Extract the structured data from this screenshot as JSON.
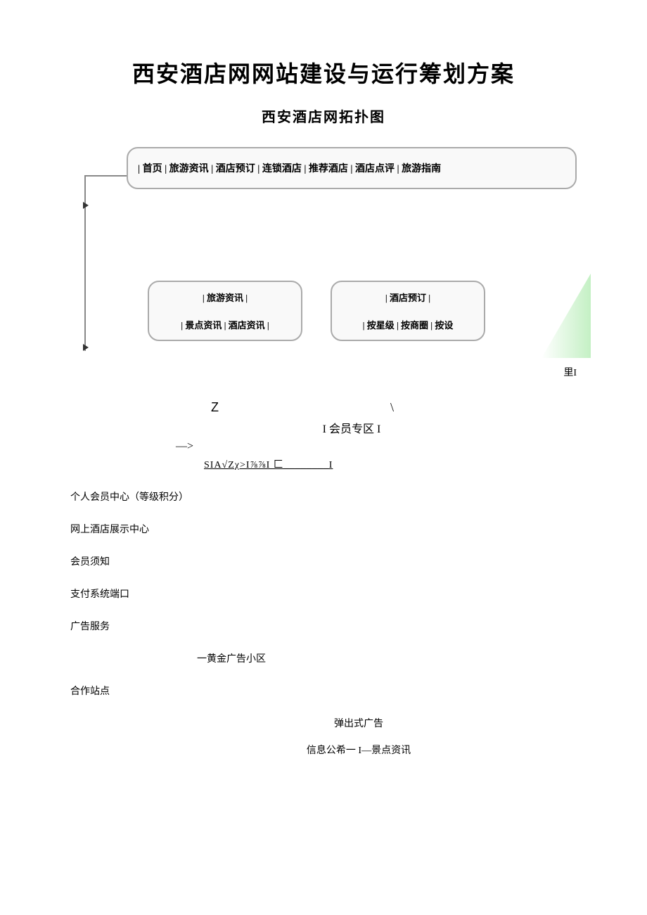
{
  "title": "西安酒店网网站建设与运行筹划方案",
  "subtitle": "西安酒店网拓扑图",
  "nav": "| 首页 | 旅游资讯 | 酒店预订 | 连锁酒店 | 推荐酒店 | 酒店点评 | 旅游指南",
  "box1": {
    "row1": "| 旅游资讯 |",
    "row2": "| 景点资讯 | 酒店资讯 |"
  },
  "box2": {
    "row1": "| 酒店预订 |",
    "row2": "| 按星级 | 按商圈 | 按设"
  },
  "li_label": "里I",
  "z": "Z",
  "backslash": "\\",
  "member_zone": "I 会员专区 I",
  "dash": "—>",
  "sia": "SIA√Zχ>I⅞⅞I 匚________I",
  "items": {
    "i1": "个人会员中心（等级积分）",
    "i2": "网上酒店展示中心",
    "i3": "会员须知",
    "i4": "支付系统端口",
    "i5": "广告服务",
    "i6": "一黄金广告小区",
    "i7": "合作站点",
    "i8": "弹出式广告",
    "i9": "信息公希一 I—景点资讯"
  }
}
